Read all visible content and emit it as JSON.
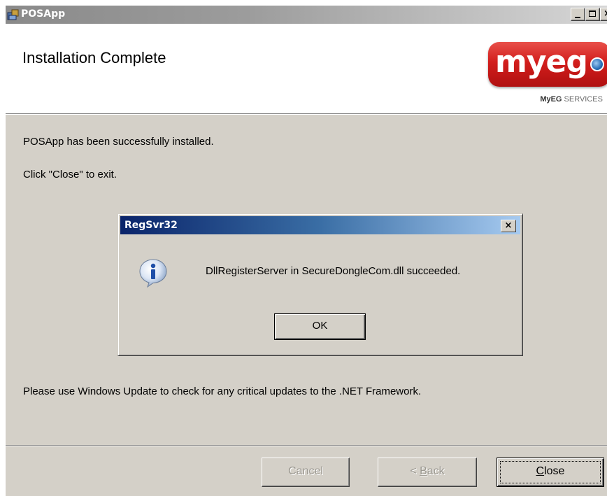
{
  "window": {
    "title": "POSApp"
  },
  "banner": {
    "heading": "Installation Complete",
    "logo_text": "myeg",
    "logo_sub_bold": "MyEG",
    "logo_sub_rest": " SERVICES"
  },
  "body": {
    "line1": "POSApp has been successfully installed.",
    "line2": "Click \"Close\" to exit.",
    "line3": "Please use Windows Update to check for any critical updates to the .NET Framework."
  },
  "dialog": {
    "title": "RegSvr32",
    "close_glyph": "×",
    "icon": "info-icon",
    "message": "DllRegisterServer in SecureDongleCom.dll succeeded.",
    "ok_label": "OK"
  },
  "footer": {
    "cancel_label": "Cancel",
    "back_prefix": "< ",
    "back_mnemonic": "B",
    "back_rest": "ack",
    "close_mnemonic": "C",
    "close_rest": "lose"
  },
  "colors": {
    "window_bg": "#d4d0c8",
    "dialog_title_start": "#0a246a",
    "dialog_title_end": "#a6caf0",
    "logo_red": "#d21e1c"
  }
}
